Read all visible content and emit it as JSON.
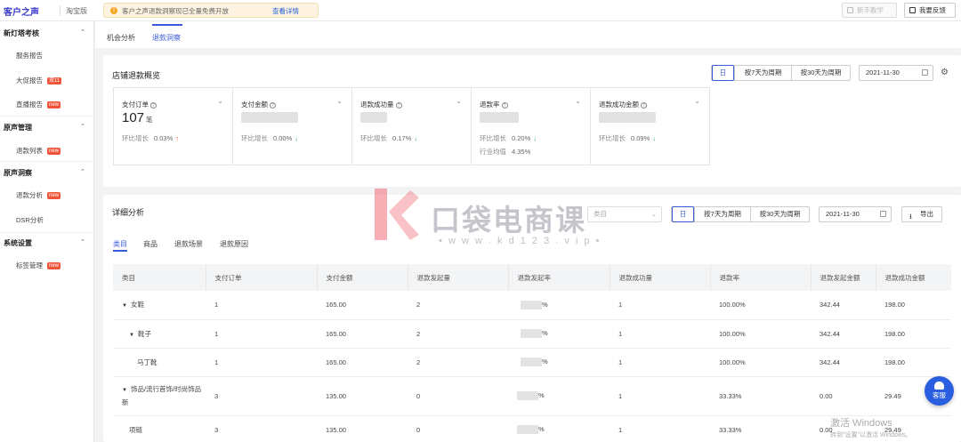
{
  "header": {
    "logo": "客户之声",
    "edition": "淘宝版",
    "notice_text": "客户之声退款洞察现已全量免费开放",
    "notice_link": "查看详情",
    "tutorial_btn": "新手教学",
    "feedback_btn": "我要反馈"
  },
  "sidebar": {
    "groups": [
      {
        "title": "新灯塔考核",
        "items": [
          {
            "label": "服务报告",
            "badge": ""
          },
          {
            "label": "大促报告",
            "badge": "双11"
          },
          {
            "label": "直播报告",
            "badge": "new"
          }
        ]
      },
      {
        "title": "原声管理",
        "items": [
          {
            "label": "退款列表",
            "badge": "new"
          }
        ]
      },
      {
        "title": "原声洞察",
        "items": [
          {
            "label": "退款分析",
            "badge": "new"
          },
          {
            "label": "DSR分析",
            "badge": ""
          }
        ]
      },
      {
        "title": "系统设置",
        "items": [
          {
            "label": "标签管理",
            "badge": "new"
          }
        ]
      }
    ]
  },
  "page_tabs": [
    "机会分析",
    "退款洞察"
  ],
  "overview": {
    "title": "店铺退款概览",
    "periods": [
      "日",
      "按7天为周期",
      "按30天为周期"
    ],
    "date": "2021-11-30",
    "kpis": [
      {
        "label": "支付订单",
        "value": "107",
        "unit": "笔",
        "hidden": false,
        "mom_label": "环比增长",
        "mom_value": "0.03%",
        "trend": "up",
        "extra_label": "",
        "extra_value": ""
      },
      {
        "label": "支付金额",
        "value": "",
        "unit": "",
        "hidden": true,
        "mom_label": "环比增长",
        "mom_value": "0.00%",
        "trend": "down",
        "extra_label": "",
        "extra_value": ""
      },
      {
        "label": "退款成功量",
        "value": "",
        "unit": "",
        "hidden": true,
        "mom_label": "环比增长",
        "mom_value": "0.17%",
        "trend": "down",
        "extra_label": "",
        "extra_value": ""
      },
      {
        "label": "退款率",
        "value": "",
        "unit": "",
        "hidden": true,
        "mom_label": "环比增长",
        "mom_value": "0.20%",
        "trend": "down",
        "extra_label": "行业均值",
        "extra_value": "4.35%"
      },
      {
        "label": "退款成功金额",
        "value": "",
        "unit": "",
        "hidden": true,
        "mom_label": "环比增长",
        "mom_value": "0.09%",
        "trend": "down",
        "extra_label": "",
        "extra_value": ""
      }
    ]
  },
  "detail": {
    "title": "详细分析",
    "category_placeholder": "类目",
    "periods": [
      "日",
      "按7天为周期",
      "按30天为周期"
    ],
    "date": "2021-11-30",
    "export_label": "导出",
    "subtabs": [
      "类目",
      "商品",
      "退款场景",
      "退款原因"
    ],
    "columns": [
      "类目",
      "支付订单",
      "支付金额",
      "退款发起量",
      "退款发起率",
      "退款成功量",
      "退款率",
      "退款发起金额",
      "退款成功金额"
    ],
    "rows": [
      {
        "name": "女鞋",
        "indent": 0,
        "caret": true,
        "orders": "1",
        "amount": "165.00",
        "initiated": "2",
        "init_rate": "%",
        "success": "1",
        "refund_rate": "100.00%",
        "init_amount": "342.44",
        "success_amount": "198.00"
      },
      {
        "name": "靴子",
        "indent": 1,
        "caret": true,
        "orders": "1",
        "amount": "165.00",
        "initiated": "2",
        "init_rate": "%",
        "success": "1",
        "refund_rate": "100.00%",
        "init_amount": "342.44",
        "success_amount": "198.00"
      },
      {
        "name": "马丁靴",
        "indent": 2,
        "caret": false,
        "orders": "1",
        "amount": "165.00",
        "initiated": "2",
        "init_rate": "%",
        "success": "1",
        "refund_rate": "100.00%",
        "init_amount": "342.44",
        "success_amount": "198.00"
      },
      {
        "name": "饰品/流行首饰/时尚饰品新",
        "indent": 0,
        "caret": true,
        "orders": "3",
        "amount": "135.00",
        "initiated": "0",
        "init_rate": "%",
        "success": "1",
        "refund_rate": "33.33%",
        "init_amount": "0.00",
        "success_amount": "29.49"
      },
      {
        "name": "项链",
        "indent": 2,
        "caret": false,
        "orders": "3",
        "amount": "135.00",
        "initiated": "0",
        "init_rate": "%",
        "success": "1",
        "refund_rate": "33.33%",
        "init_amount": "0.00",
        "success_amount": "29.49"
      }
    ]
  },
  "service_btn": "客服",
  "watermark": {
    "brand": "口袋电商课",
    "url": "• w w w . k d 1 2 3 . v i p •",
    "windows_line1": "激活 Windows",
    "windows_line2": "转到\"设置\"以激活 Windows。"
  },
  "colors": {
    "accent": "#3a5bd9",
    "badge": "#f0553a",
    "up": "#f0553a",
    "down": "#2aa876"
  }
}
